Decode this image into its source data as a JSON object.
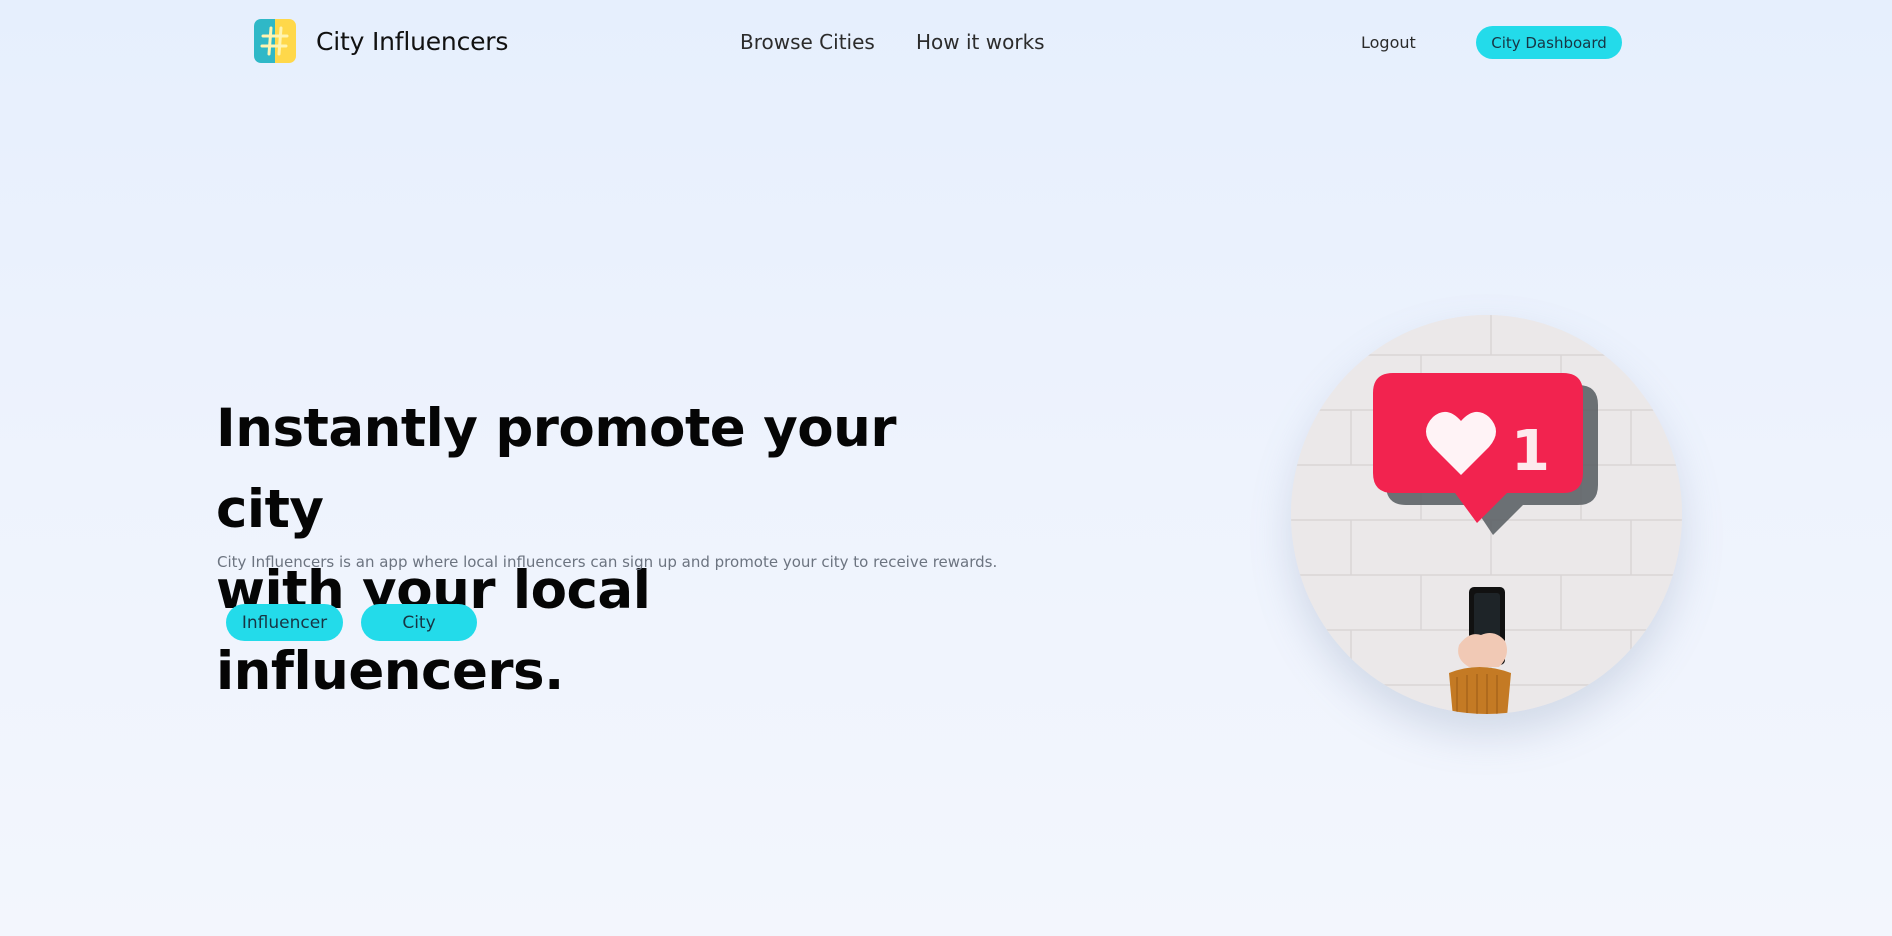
{
  "header": {
    "brand": "City Influencers",
    "logo_icon": "hashtag-icon",
    "nav": [
      {
        "label": "Browse Cities"
      },
      {
        "label": "How it works"
      }
    ],
    "logout_label": "Logout",
    "dashboard_label": "City Dashboard"
  },
  "hero": {
    "title_line1": "Instantly promote your city",
    "title_line2": "with your local influencers.",
    "subtitle": "City Influencers is an app where local influencers can sign up and promote your city to receive rewards.",
    "buttons": [
      {
        "label": "Influencer"
      },
      {
        "label": "City"
      }
    ],
    "image": {
      "icon": "like-notification-icon",
      "badge_count": "1"
    }
  },
  "colors": {
    "accent": "#23dbea",
    "logo_teal": "#2fb8c7",
    "logo_yellow": "#ffd84a",
    "like_red": "#f2234f"
  }
}
